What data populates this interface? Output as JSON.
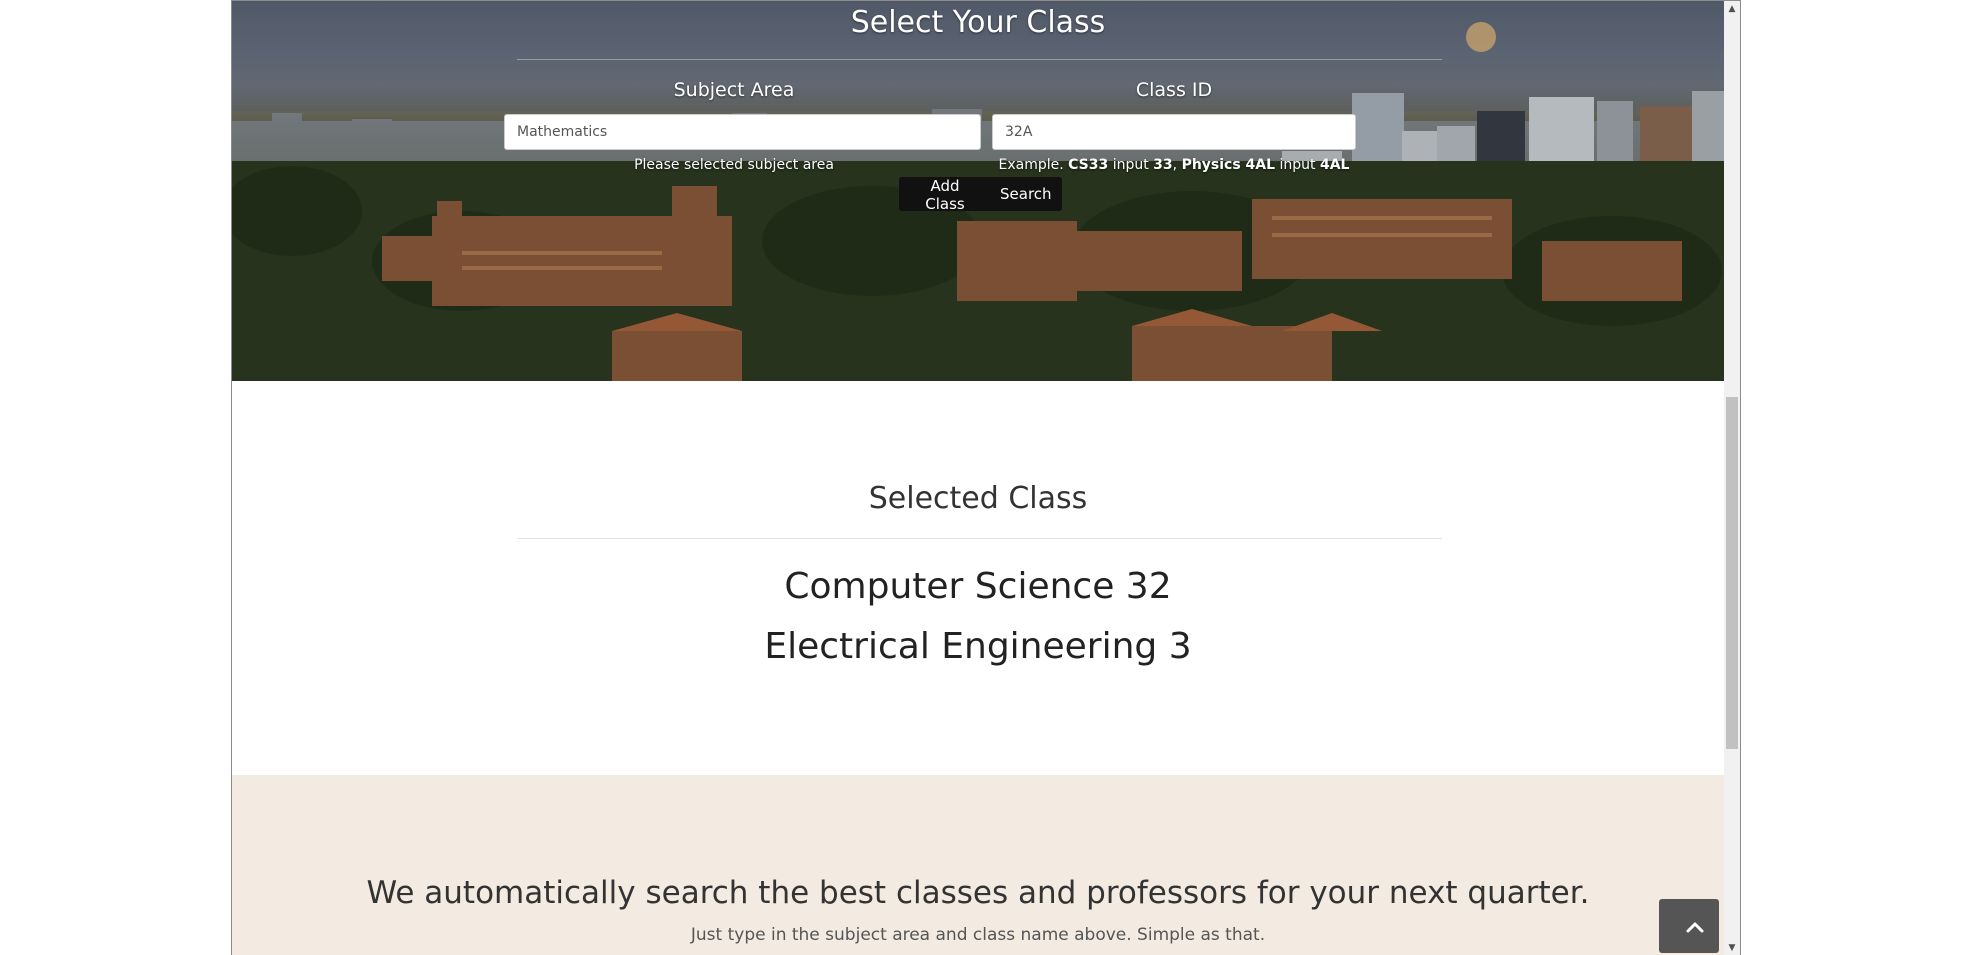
{
  "hero": {
    "title": "Select Your Class",
    "subject": {
      "label": "Subject Area",
      "value": "Mathematics",
      "help": "Please selected subject area"
    },
    "class_id": {
      "label": "Class ID",
      "value": "32A",
      "help_prefix": "Example. ",
      "help_ex1": "CS33",
      "help_mid1": " input ",
      "help_ex1_input": "33",
      "help_sep": ", ",
      "help_ex2": "Physics 4AL",
      "help_mid2": " input ",
      "help_ex2_input": "4AL"
    },
    "buttons": {
      "add": "Add Class",
      "search": "Search"
    }
  },
  "selected": {
    "title": "Selected Class",
    "items": [
      "Computer Science 32",
      "Electrical Engineering 3"
    ]
  },
  "info": {
    "headline": "We automatically search the best classes and professors for your next quarter.",
    "subtext": "Just type in the subject area and class name above. Simple as that."
  },
  "icons": {
    "back_to_top": "chevron-up-icon",
    "scroll_up": "triangle-up-icon",
    "scroll_down": "triangle-down-icon"
  },
  "colors": {
    "button_bg": "#111111",
    "info_bg": "#f3ebe1",
    "back_top_bg": "#555555"
  }
}
